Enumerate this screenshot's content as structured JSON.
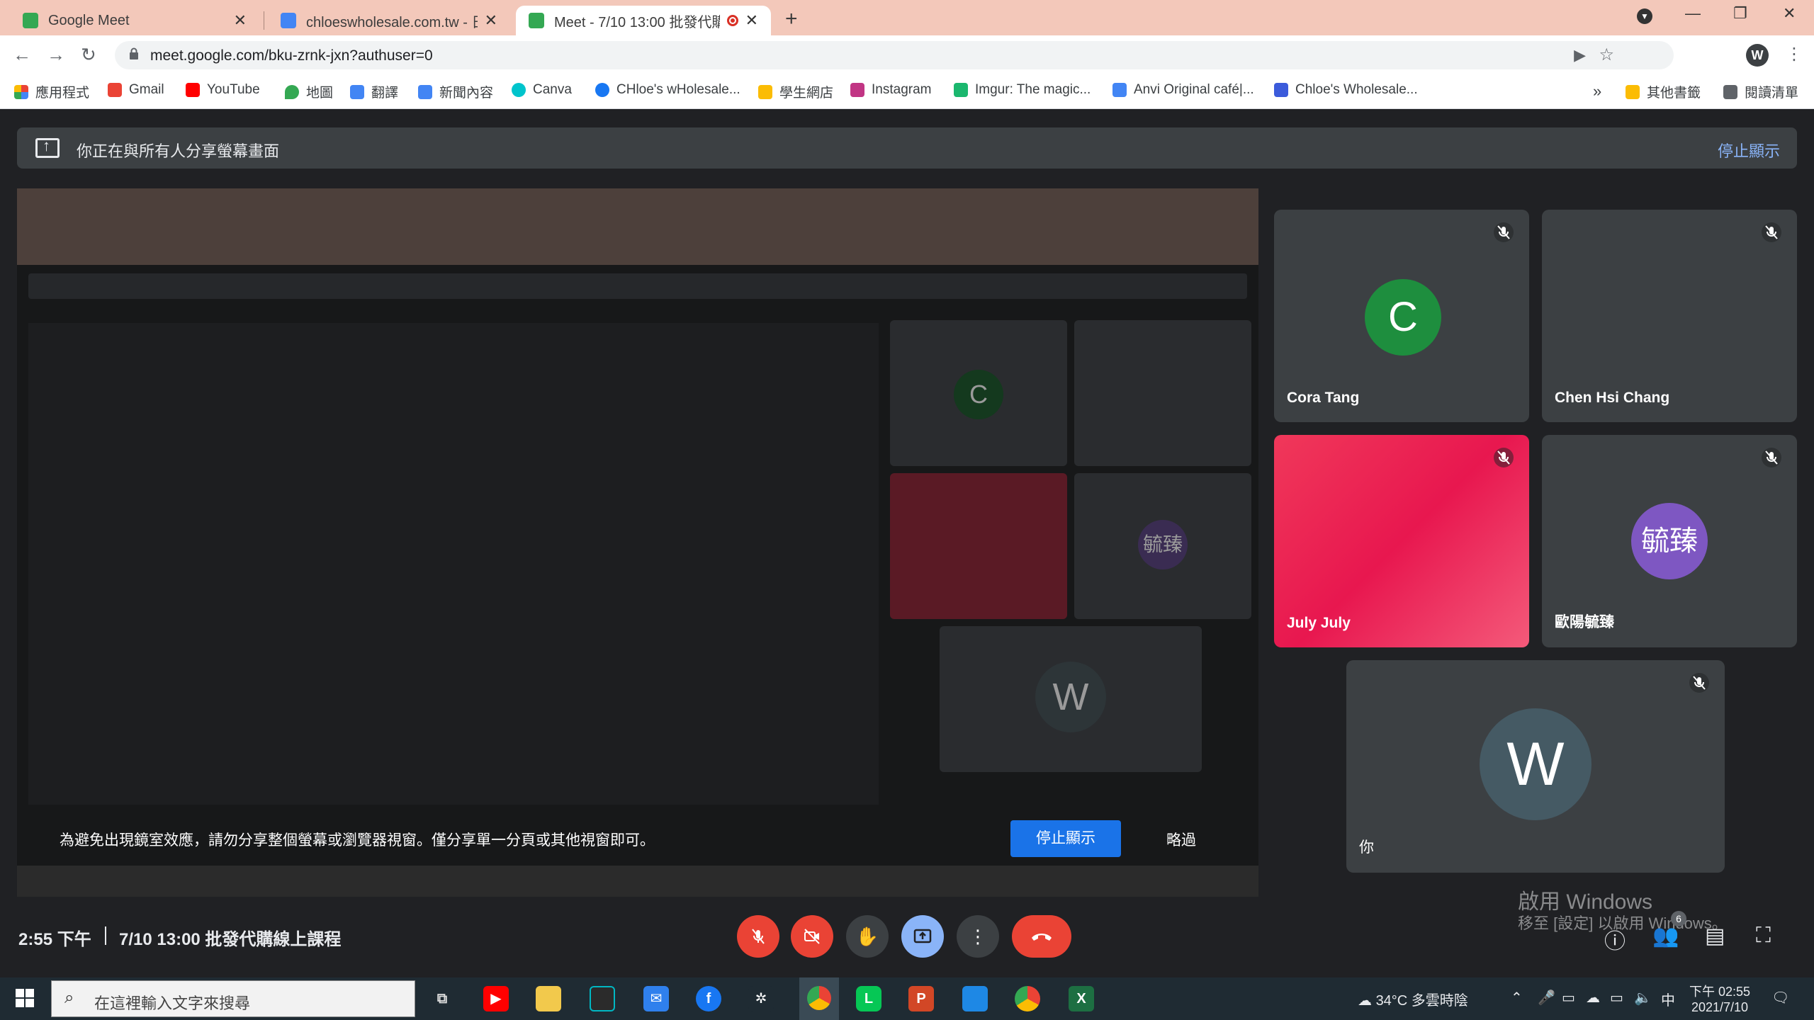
{
  "browser": {
    "tabs": [
      {
        "title": "Google Meet",
        "color": "#34a853"
      },
      {
        "title": "chloeswholesale.com.tw - 日曆",
        "color": "#4285f4"
      },
      {
        "title": "Meet - 7/10 13:00 批發代購",
        "color": "#34a853"
      }
    ],
    "url": "meet.google.com/bku-zrnk-jxn?authuser=0",
    "profile_initial": "W",
    "bookmarks": [
      {
        "label": "應用程式",
        "color": "#ea4335"
      },
      {
        "label": "Gmail",
        "color": "#ea4335"
      },
      {
        "label": "YouTube",
        "color": "#ff0000"
      },
      {
        "label": "地圖",
        "color": "#34a853"
      },
      {
        "label": "翻譯",
        "color": "#4285f4"
      },
      {
        "label": "新聞內容",
        "color": "#4285f4"
      },
      {
        "label": "Canva",
        "color": "#00c4cc"
      },
      {
        "label": "CHloe's wHolesale...",
        "color": "#1877f2"
      },
      {
        "label": "學生網店",
        "color": "#fbbc04"
      },
      {
        "label": "Instagram",
        "color": "#c13584"
      },
      {
        "label": "Imgur: The magic...",
        "color": "#1bb76e"
      },
      {
        "label": "Anvi Original café|...",
        "color": "#4285f4"
      },
      {
        "label": "Chloe's Wholesale...",
        "color": "#3b5bdb"
      }
    ],
    "bookmarks_overflow": "»",
    "other_bookmarks": "其他書籤",
    "reading_list": "閱讀清單"
  },
  "meet": {
    "share_banner_text": "你正在與所有人分享螢幕畫面",
    "stop_sharing": "停止顯示",
    "warning_text": "為避免出現鏡室效應，請勿分享整個螢幕或瀏覽器視窗。僅分享單一分頁或其他視窗即可。",
    "warning_stop": "停止顯示",
    "warning_skip": "略過",
    "participants": [
      {
        "name": "Cora Tang",
        "initial": "C",
        "avatar_color": "#1e8e3e"
      },
      {
        "name": "Chen Hsi Chang",
        "initial": "",
        "avatar_color": ""
      },
      {
        "name": "July July",
        "initial": "",
        "avatar_color": ""
      },
      {
        "name": "歐陽毓臻",
        "initial": "毓臻",
        "avatar_color": "#7e57c2"
      },
      {
        "name": "你",
        "initial": "W",
        "avatar_color": "#455a64"
      }
    ],
    "time": "2:55 下午",
    "meeting_title": "7/10 13:00 批發代購線上課程",
    "activate_windows": "啟用 Windows",
    "activate_windows_sub": "移至 [設定] 以啟用 Windows。",
    "participant_count": "6"
  },
  "taskbar": {
    "search_placeholder": "在這裡輸入文字來搜尋",
    "weather": "34°C  多雲時陰",
    "ime": "中",
    "clock_time": "下午 02:55",
    "clock_date": "2021/7/10"
  }
}
